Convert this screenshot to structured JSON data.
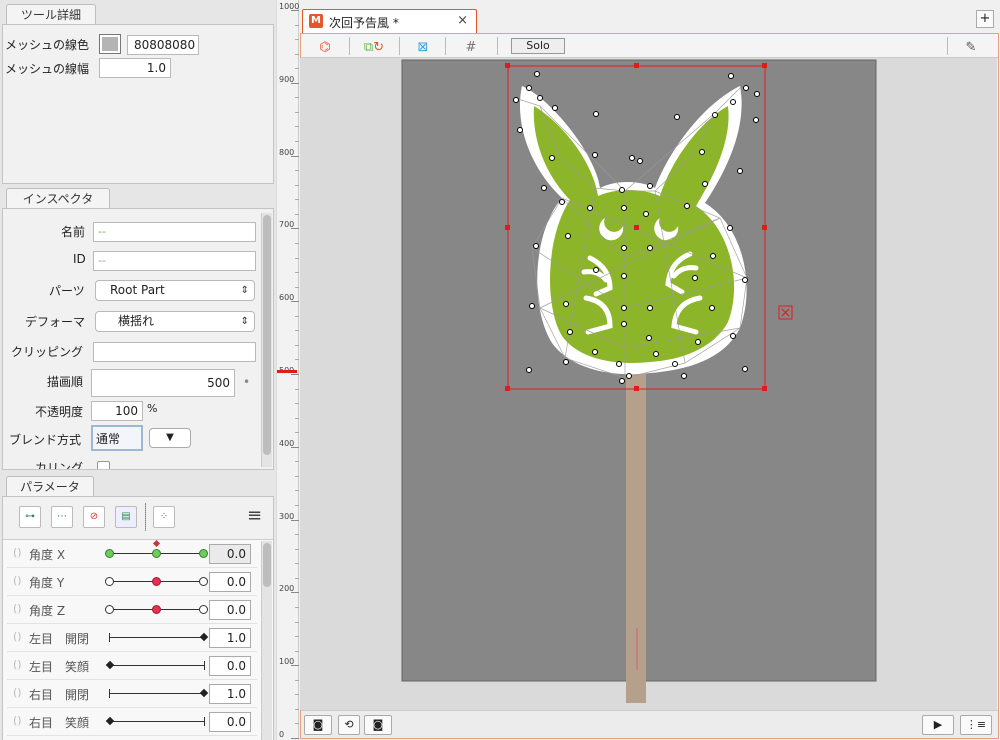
{
  "tool_detail": {
    "tab": "ツール詳細",
    "mesh_line_color_label": "メッシュの線色",
    "mesh_line_color_value": "80808080",
    "mesh_line_color_swatch": "#b4b4b4",
    "mesh_line_width_label": "メッシュの線幅",
    "mesh_line_width_value": "1.0"
  },
  "inspector": {
    "tab": "インスペクタ",
    "name_label": "名前",
    "name_value": "--",
    "id_label": "ID",
    "id_value": "--",
    "parts_label": "パーツ",
    "parts_value": "Root Part",
    "deformer_label": "デフォーマ",
    "deformer_value": "横揺れ",
    "clipping_label": "クリッピング",
    "clipping_value": "",
    "draw_order_label": "描画順",
    "draw_order_value": "500",
    "draw_order_marker": "•",
    "opacity_label": "不透明度",
    "opacity_value": "100",
    "opacity_unit": "%",
    "blend_label": "ブレンド方式",
    "blend_value": "通常",
    "culling_label": "カリング"
  },
  "parameters": {
    "tab": "パラメータ",
    "rows": [
      {
        "name": "角度 X",
        "value": "0.0"
      },
      {
        "name": "角度 Y",
        "value": "0.0"
      },
      {
        "name": "角度 Z",
        "value": "0.0"
      },
      {
        "name": "左目　開閉",
        "value": "1.0"
      },
      {
        "name": "左目　笑顔",
        "value": "0.0"
      },
      {
        "name": "右目　開閉",
        "value": "1.0"
      },
      {
        "name": "右目　笑顔",
        "value": "0.0"
      }
    ]
  },
  "document": {
    "tab_icon": "M",
    "tab_title": "次回予告風 *",
    "close": "×",
    "add": "+"
  },
  "toolbar": {
    "solo": "Solo"
  },
  "ruler": {
    "labels": [
      "1000",
      "900",
      "800",
      "700",
      "600",
      "500",
      "400",
      "300",
      "200",
      "100",
      "0"
    ]
  },
  "colors": {
    "accent": "#e8552b",
    "mesh_fill": "#8db52a",
    "canvas": "#878787",
    "stick": "#b5a08c",
    "selection": "#e01b1b"
  },
  "icons": {
    "menu": "≡",
    "play": "▶",
    "list": "⋮≡"
  }
}
